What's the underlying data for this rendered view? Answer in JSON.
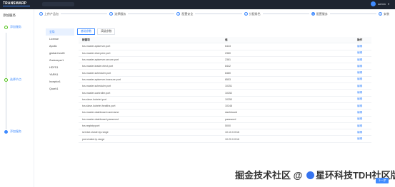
{
  "topbar": {
    "logo": "TRANSWARP",
    "user": "admin"
  },
  "sidebar": {
    "title": "添加服务",
    "steps": [
      {
        "label": "添加服务"
      },
      {
        "label": "选择节点"
      },
      {
        "label": "添加服务"
      }
    ]
  },
  "progress": {
    "steps": [
      {
        "num": "1",
        "label": "上传产品包"
      },
      {
        "num": "2",
        "label": "选择服务"
      },
      {
        "num": "3",
        "label": "配置安全"
      },
      {
        "num": "4",
        "label": "分配角色"
      },
      {
        "num": "5",
        "label": "配置服务"
      },
      {
        "num": "6",
        "label": "安装"
      }
    ]
  },
  "services": [
    "全局",
    "License",
    "Apollo",
    "global-fundG",
    "Zookeeper1",
    "HDFS1",
    "YARN1",
    "Inceptor1",
    "Quark1"
  ],
  "subtabs": [
    "基础参数",
    "高级参数"
  ],
  "table": {
    "headers": [
      "配置项",
      "值",
      "操作"
    ],
    "rows": [
      [
        "tos.master.apiserver.port",
        "6443",
        "编辑"
      ],
      [
        "tos.master.etcd.peer.port",
        "2380",
        "编辑"
      ],
      [
        "tos.master.apiserver.secure.port",
        "2381",
        "编辑"
      ],
      [
        "tos.master.leader.elect.port",
        "8442",
        "编辑"
      ],
      [
        "tos.master.scheduler.port",
        "8480",
        "编辑"
      ],
      [
        "tos.master.apiserver.insecure.port",
        "8553",
        "编辑"
      ],
      [
        "tos.master.scheduler.port",
        "10251",
        "编辑"
      ],
      [
        "tos.master.controller.port",
        "10252",
        "编辑"
      ],
      [
        "tos.slave.kubelet.port",
        "10250",
        "编辑"
      ],
      [
        "tos.slave.kubelet.healthz.port",
        "10248",
        "编辑"
      ],
      [
        "tos.master.dashboard.username",
        "dashboard",
        "编辑"
      ],
      [
        "tos.master.dashboard.password",
        "password",
        "编辑"
      ],
      [
        "tos.registry.port",
        "5000",
        "编辑"
      ],
      [
        "service.cluster.ip.range",
        "10.10.0.0/16",
        "编辑"
      ],
      [
        "pod.cluster.ip.range",
        "10.20.0.0/16",
        "编辑"
      ]
    ]
  },
  "watermark": {
    "left": "掘金技术社区",
    "at": "@",
    "right": "星环科技TDH社区版"
  },
  "actions": {
    "next": "下一步"
  }
}
